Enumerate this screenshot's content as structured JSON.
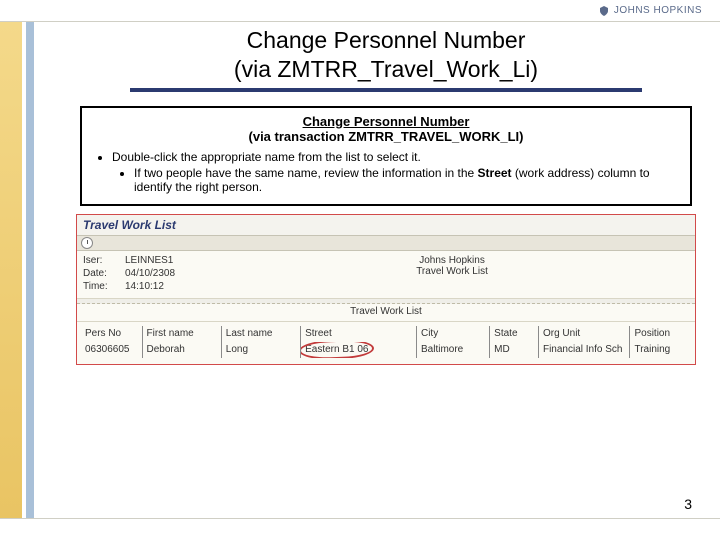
{
  "topbar": {
    "brand": "JOHNS HOPKINS"
  },
  "slide_title_line1": "Change Personnel Number",
  "slide_title_line2": "(via ZMTRR_Travel_Work_Li)",
  "box": {
    "head_underlined": "Change Personnel Number",
    "head_line2": "(via transaction ZMTRR_TRAVEL_WORK_LI)",
    "bullet_main": "Double-click the appropriate name from the list to select it.",
    "bullet_sub_prefix": "If two people have the same name, review the information in the ",
    "bullet_sub_bold": "Street",
    "bullet_sub_suffix": " (work address) column to identify the right person."
  },
  "sap": {
    "window_title": "Travel Work List",
    "meta_labels": {
      "user": "Iser:",
      "date": "Date:",
      "time": "Time:"
    },
    "meta": {
      "user": "LEINNES1",
      "date": "04/10/2308",
      "time": "14:10:12"
    },
    "header_title_line1": "Johns Hopkins",
    "header_title_line2": "Travel Work List",
    "caption": "Travel Work List",
    "columns": [
      "Pers No",
      "First name",
      "Last name",
      "Street",
      "City",
      "State",
      "Org Unit",
      "Position"
    ],
    "rows": [
      {
        "pers_no": "06306605",
        "first_name": "Deborah",
        "last_name": "Long",
        "street": "Eastern B1 06",
        "city": "Baltimore",
        "state": "MD",
        "org_unit": "Financial Info Sch",
        "position": "Training"
      }
    ]
  },
  "page_number": "3"
}
